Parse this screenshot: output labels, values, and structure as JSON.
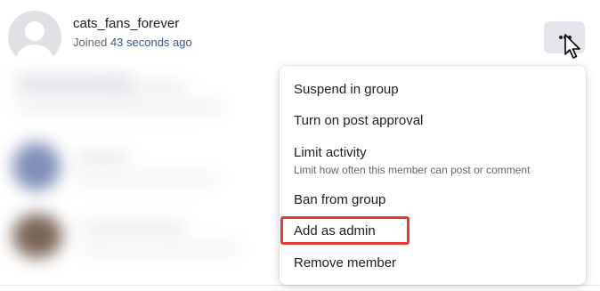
{
  "member": {
    "name": "cats_fans_forever",
    "joined_prefix": "Joined",
    "joined_time": "43 seconds ago"
  },
  "menu": {
    "items": [
      {
        "label": "Suspend in group"
      },
      {
        "label": "Turn on post approval"
      },
      {
        "label": "Limit activity",
        "description": "Limit how often this member can post or comment"
      },
      {
        "label": "Ban from group"
      },
      {
        "label": "Add as admin",
        "highlighted": true
      },
      {
        "label": "Remove member"
      }
    ]
  },
  "icons": {
    "avatar": "default-profile-icon",
    "more": "more-options-icon",
    "cursor": "mouse-pointer-icon"
  },
  "colors": {
    "highlight_border": "#e53935",
    "secondary_text": "#65676b",
    "link_time": "#385898",
    "button_background": "#e4e6eb"
  }
}
